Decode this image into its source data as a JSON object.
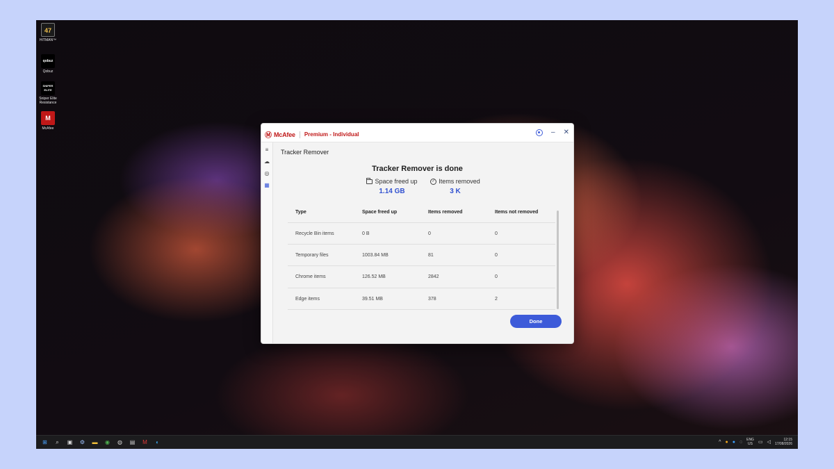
{
  "desktop": {
    "icons": [
      {
        "label": "HITMAN™",
        "glyph": "47",
        "bg": "#1b1b1b",
        "fg": "#f2c14e"
      },
      {
        "label": "Qobuz",
        "glyph": "qobuz",
        "bg": "#000000",
        "fg": "#ffffff"
      },
      {
        "label": "Sniper Elite\nResistance",
        "glyph": "SNIPER ELITE",
        "bg": "#000000",
        "fg": "#ffffff"
      },
      {
        "label": "McAfee",
        "glyph": "M",
        "bg": "#c01818",
        "fg": "#ffffff"
      }
    ]
  },
  "window": {
    "brand": "McAfee",
    "plan": "Premium - Individual",
    "help_icon": "help-circle-icon",
    "minimize_glyph": "–",
    "close_glyph": "✕",
    "page_title": "Tracker Remover",
    "heading": "Tracker Remover is done",
    "stats": {
      "space_label": "Space freed up",
      "space_value": "1.14 GB",
      "items_label": "Items removed",
      "items_value": "3 K"
    },
    "table": {
      "headers": [
        "Type",
        "Space freed up",
        "Items removed",
        "Items not removed"
      ],
      "rows": [
        [
          "Recycle Bin items",
          "0 B",
          "0",
          "0"
        ],
        [
          "Temporary files",
          "1003.84 MB",
          "81",
          "0"
        ],
        [
          "Chrome items",
          "126.52 MB",
          "2842",
          "0"
        ],
        [
          "Edge items",
          "39.51 MB",
          "378",
          "2"
        ]
      ]
    },
    "done_label": "Done"
  },
  "taskbar": {
    "tray": {
      "lang_top": "ENG",
      "lang_bottom": "US",
      "time": "12:15",
      "date": "17/08/2026"
    }
  },
  "colors": {
    "accent": "#3d5bd9",
    "brand": "#c01818",
    "background": "#c6d3fb"
  }
}
